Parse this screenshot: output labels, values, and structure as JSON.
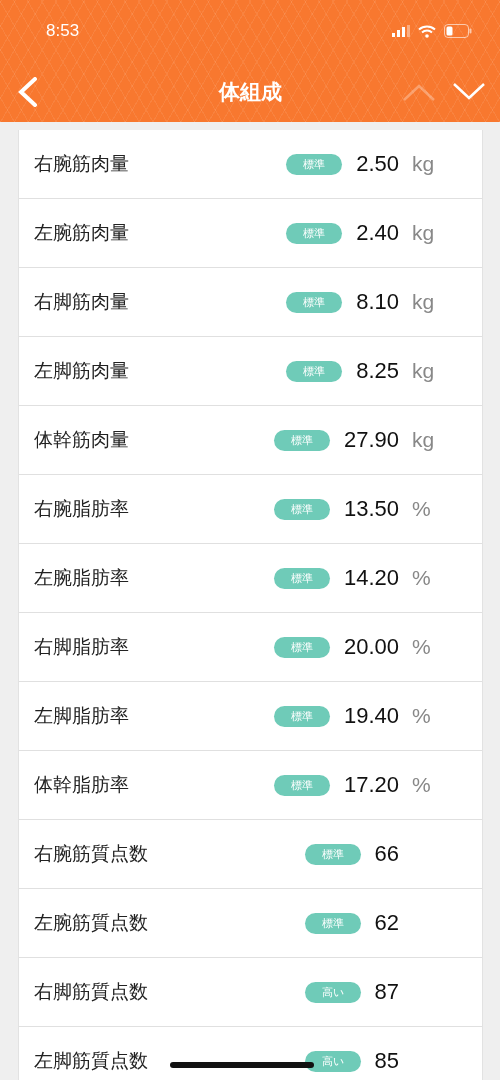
{
  "status_bar": {
    "time": "8:53"
  },
  "header": {
    "title": "体組成",
    "nav": [
      {
        "kind": "up",
        "disabled": true
      },
      {
        "kind": "down",
        "disabled": false
      }
    ]
  },
  "rows": [
    {
      "label": "右腕筋肉量",
      "badge": "標準",
      "value": "2.50",
      "unit": "kg"
    },
    {
      "label": "左腕筋肉量",
      "badge": "標準",
      "value": "2.40",
      "unit": "kg"
    },
    {
      "label": "右脚筋肉量",
      "badge": "標準",
      "value": "8.10",
      "unit": "kg"
    },
    {
      "label": "左脚筋肉量",
      "badge": "標準",
      "value": "8.25",
      "unit": "kg"
    },
    {
      "label": "体幹筋肉量",
      "badge": "標準",
      "value": "27.90",
      "unit": "kg"
    },
    {
      "label": "右腕脂肪率",
      "badge": "標準",
      "value": "13.50",
      "unit": "%"
    },
    {
      "label": "左腕脂肪率",
      "badge": "標準",
      "value": "14.20",
      "unit": "%"
    },
    {
      "label": "右脚脂肪率",
      "badge": "標準",
      "value": "20.00",
      "unit": "%"
    },
    {
      "label": "左脚脂肪率",
      "badge": "標準",
      "value": "19.40",
      "unit": "%"
    },
    {
      "label": "体幹脂肪率",
      "badge": "標準",
      "value": "17.20",
      "unit": "%"
    },
    {
      "label": "右腕筋質点数",
      "badge": "標準",
      "value": "66"
    },
    {
      "label": "左腕筋質点数",
      "badge": "標準",
      "value": "62"
    },
    {
      "label": "右脚筋質点数",
      "badge": "高い",
      "value": "87"
    },
    {
      "label": "左脚筋質点数",
      "badge": "高い",
      "value": "85"
    }
  ]
}
